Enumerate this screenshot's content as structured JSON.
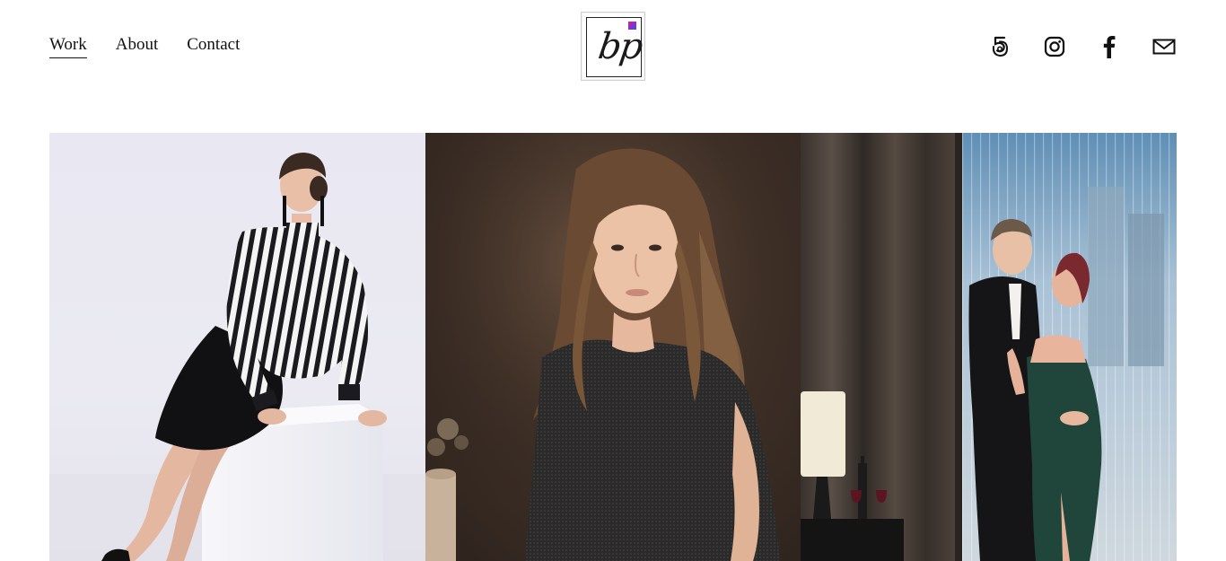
{
  "nav": {
    "items": [
      {
        "label": "Work",
        "active": true
      },
      {
        "label": "About",
        "active": false
      },
      {
        "label": "Contact",
        "active": false
      }
    ]
  },
  "logo": {
    "monogram": "bp"
  },
  "social": {
    "icons": [
      "500px-icon",
      "instagram-icon",
      "facebook-icon",
      "email-icon"
    ]
  },
  "gallery": {
    "images": [
      {
        "name": "photo-woman-striped-blouse-on-white-block",
        "description": "Model in black and white striped blouse and black skirt seated on white cube"
      },
      {
        "name": "photo-girl-wavy-hair-dark-dress",
        "description": "Portrait of girl with long wavy hair in dark dress on brown background"
      },
      {
        "name": "photo-couple-embracing-by-window",
        "description": "Couple embracing near window with curtains and city view"
      }
    ]
  },
  "colors": {
    "text": "#111111",
    "background": "#ffffff"
  }
}
